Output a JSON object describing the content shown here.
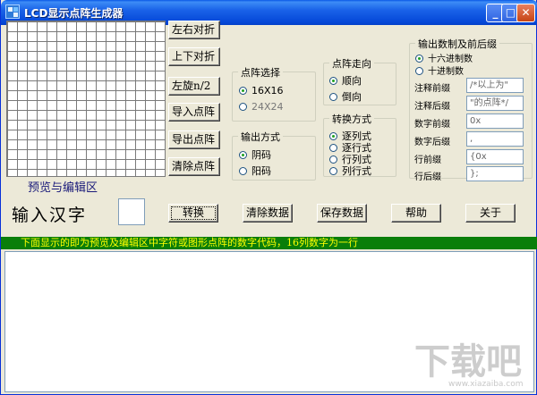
{
  "window": {
    "title": "LCD显示点阵生成器"
  },
  "grid": {
    "rows": 16,
    "cols": 16
  },
  "preview_label": "预览与编辑区",
  "side_buttons": [
    "左右对折",
    "上下对折",
    "左旋n/2",
    "导入点阵",
    "导出点阵",
    "清除点阵"
  ],
  "dot_select": {
    "title": "点阵选择",
    "options": [
      "16X16",
      "24X24"
    ],
    "selected": 0
  },
  "output_mode": {
    "title": "输出方式",
    "options": [
      "阴码",
      "阳码"
    ],
    "selected": 0
  },
  "scan_dir": {
    "title": "点阵走向",
    "options": [
      "顺向",
      "倒向"
    ],
    "selected": 0
  },
  "convert_mode": {
    "title": "转换方式",
    "options": [
      "逐列式",
      "逐行式",
      "行列式",
      "列行式"
    ],
    "selected": 0
  },
  "number_format": {
    "title": "输出数制及前后缀",
    "options": [
      "十六进制数",
      "十进制数"
    ],
    "selected": 0,
    "fields": [
      {
        "label": "注释前缀",
        "value": "/*以上为\""
      },
      {
        "label": "注释后缀",
        "value": "\"的点阵*/"
      },
      {
        "label": "数字前缀",
        "value": "0x"
      },
      {
        "label": "数字后缀",
        "value": ","
      },
      {
        "label": "行前缀",
        "value": "{0x"
      },
      {
        "label": "行后缀",
        "value": "};"
      }
    ]
  },
  "input": {
    "label": "输入汉字",
    "value": ""
  },
  "actions": [
    "转换",
    "清除数据",
    "保存数据",
    "帮助",
    "关于"
  ],
  "status_strip": "下面显示的即为预览及编辑区中字符或图形点阵的数字代码，16列数字为一行",
  "watermark": {
    "main": "下载吧",
    "sub": "www.xiazaiba.com"
  }
}
